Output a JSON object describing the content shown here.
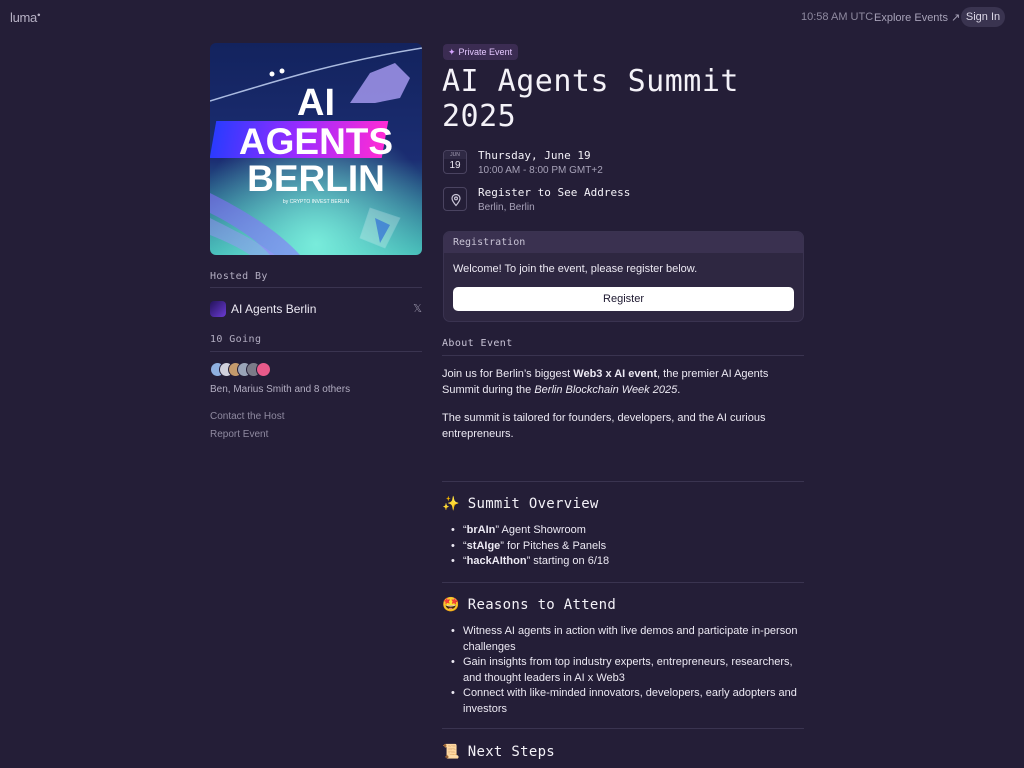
{
  "topbar": {
    "logo": "luma",
    "time": "10:58 AM UTC",
    "explore_label": "Explore Events ↗",
    "signin_label": "Sign In"
  },
  "cover": {
    "line1": "AI",
    "line2": "AGENTS",
    "line3": "BERLIN",
    "byline": "by CRYPTO INVEST BERLIN"
  },
  "host": {
    "section_label": "Hosted By",
    "name": "AI Agents Berlin"
  },
  "going": {
    "section_label": "10 Going",
    "attendees_text": "Ben, Marius Smith and 8 others",
    "avatar_colors": [
      "#8fb0e0",
      "#d0d0dc",
      "#c49a6c",
      "#9aa4b8",
      "#7b7b88",
      "#e85a8a"
    ]
  },
  "links": {
    "contact": "Contact the Host",
    "report": "Report Event"
  },
  "event": {
    "badge": "Private Event",
    "title": "AI Agents Summit 2025",
    "cal_month": "JUN",
    "cal_day": "19",
    "date": "Thursday, June 19",
    "time": "10:00 AM - 8:00 PM GMT+2",
    "address_title": "Register to See Address",
    "address_sub": "Berlin, Berlin"
  },
  "registration": {
    "header": "Registration",
    "text": "Welcome! To join the event, please register below.",
    "button": "Register"
  },
  "about": {
    "label": "About Event",
    "p1_a": "Join us for Berlin’s biggest ",
    "p1_b": "Web3 x AI event",
    "p1_c": ", the premier AI Agents Summit during the ",
    "p1_d": "Berlin Blockchain Week 2025",
    "p1_e": ".",
    "p2": "The summit is tailored for founders, developers, and the AI curious entrepreneurs."
  },
  "overview": {
    "emoji": "✨",
    "heading": "Summit Overview",
    "items": [
      {
        "bold": "brAIn",
        "rest": " Agent Showroom"
      },
      {
        "bold": "stAIge",
        "rest": " for Pitches & Panels"
      },
      {
        "bold": "hackAIthon",
        "rest": " starting on 6/18"
      }
    ]
  },
  "reasons": {
    "emoji": "🤩",
    "heading": "Reasons to Attend",
    "items": [
      "Witness AI agents in action with live demos and participate in-person challenges",
      "Gain insights from top industry experts, entrepreneurs, researchers, and thought leaders in AI x Web3",
      "Connect with like-minded innovators, developers, early adopters and investors"
    ]
  },
  "next": {
    "emoji": "📜",
    "heading": "Next Steps"
  }
}
